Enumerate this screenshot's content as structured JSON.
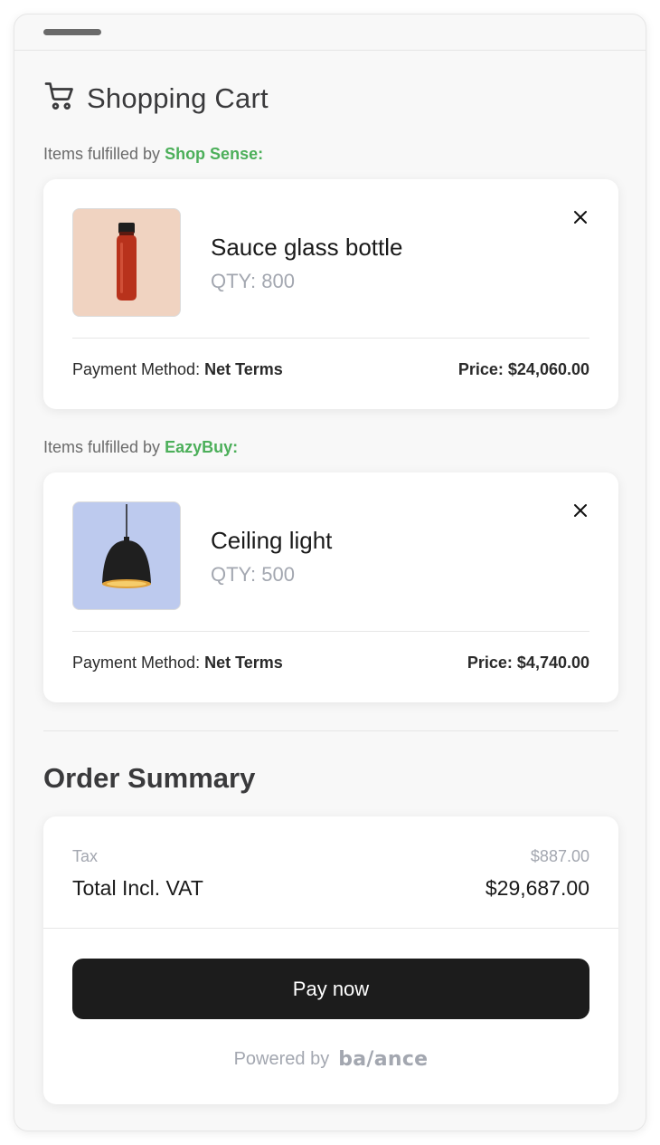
{
  "header": {
    "title": "Shopping Cart",
    "icon": "cart-icon"
  },
  "groups": [
    {
      "fulfilled_prefix": "Items fulfilled by ",
      "vendor": "Shop Sense:",
      "product_name": "Sauce glass bottle",
      "qty": "QTY: 800",
      "payment_label": "Payment Method: ",
      "payment_value": "Net Terms",
      "price_label": "Price: ",
      "price_value": "$24,060.00",
      "thumb_bg": "#f0d3c1",
      "product_icon": "bottle-icon"
    },
    {
      "fulfilled_prefix": "Items fulfilled by ",
      "vendor": "EazyBuy:",
      "product_name": "Ceiling light",
      "qty": "QTY: 500",
      "payment_label": "Payment Method: ",
      "payment_value": "Net Terms",
      "price_label": "Price: ",
      "price_value": "$4,740.00",
      "thumb_bg": "#bdcaee",
      "product_icon": "pendant-lamp-icon"
    }
  ],
  "summary": {
    "title": "Order Summary",
    "tax_label": "Tax",
    "tax_value": "$887.00",
    "total_label": "Total Incl. VAT",
    "total_value": "$29,687.00",
    "pay_button": "Pay now",
    "powered_by": "Powered by",
    "brand": "ba/ance"
  },
  "colors": {
    "vendor_accent": "#4caf5a",
    "button_bg": "#1c1c1c",
    "muted_text": "#a3a7b0"
  }
}
